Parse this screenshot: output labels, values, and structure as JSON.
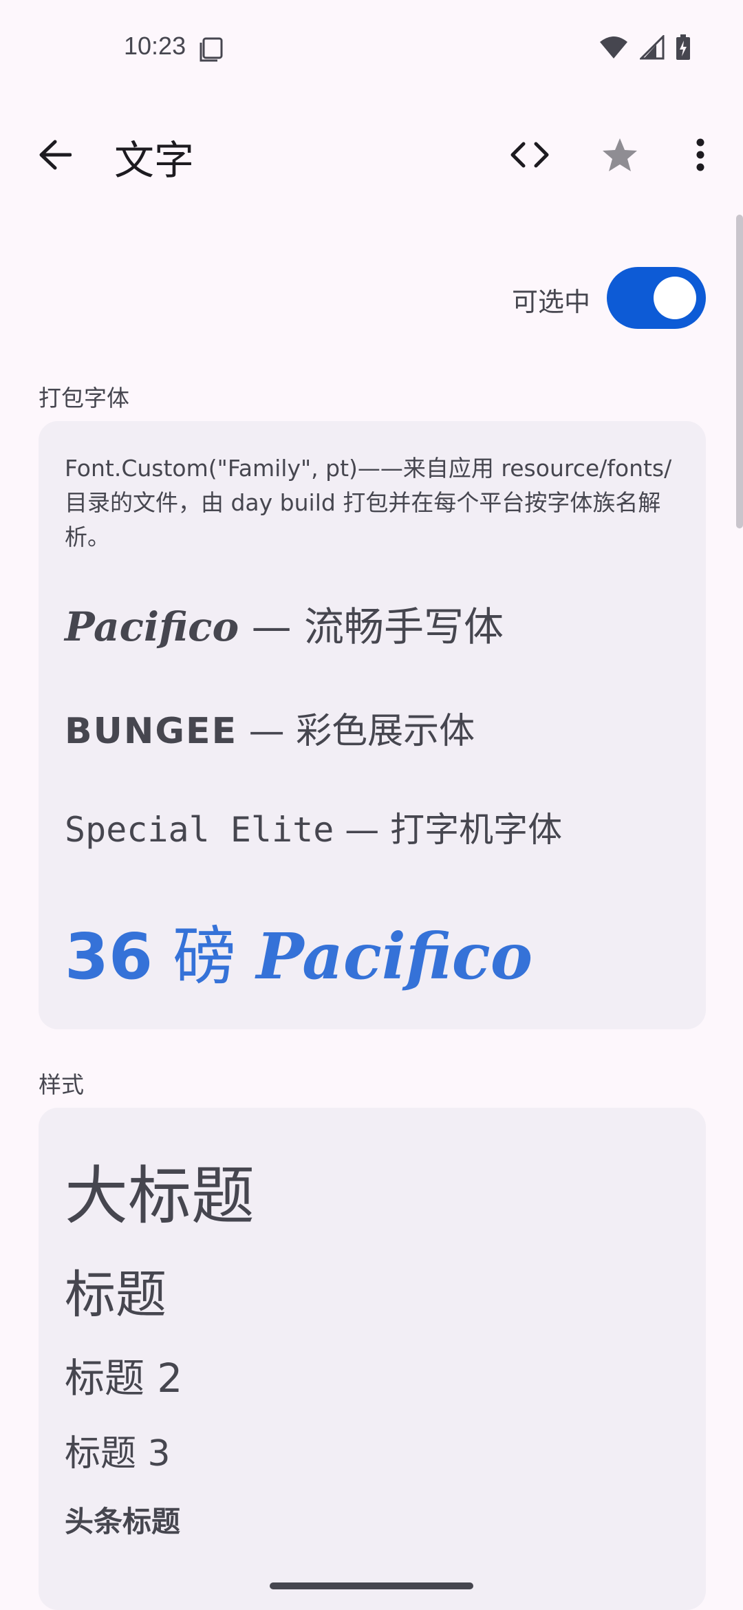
{
  "status_bar": {
    "time": "10:23",
    "icons": [
      "sim-card-icon",
      "wifi-icon",
      "cellular-signal-icon",
      "battery-charging-icon"
    ]
  },
  "app_bar": {
    "title": "文字",
    "actions": [
      "back-arrow-icon",
      "code-icon",
      "star-icon",
      "more-vert-icon"
    ]
  },
  "toggle": {
    "label": "可选中",
    "on": true,
    "color": "#0d5bd6"
  },
  "bundled_fonts": {
    "section_label": "打包字体",
    "description": "Font.Custom(\"Family\", pt)——来自应用 resource/fonts/ 目录的文件，由 day build 打包并在每个平台按字体族名解析。",
    "pacifico": {
      "name": "Pacifico",
      "suffix": " — 流畅手写体"
    },
    "bungee": {
      "name": "BUNGEE",
      "suffix": " — 彩色展示体"
    },
    "special_elite": {
      "name": "Special Elite",
      "suffix": " — 打字机字体"
    },
    "big_sample": {
      "number": "36",
      "unit": " 磅 ",
      "name": "Pacifico",
      "color": "#3572d8"
    }
  },
  "styles": {
    "section_label": "样式",
    "large_title": "大标题",
    "title": "标题",
    "title2": "标题 2",
    "title3": "标题 3",
    "headline": "头条标题"
  }
}
